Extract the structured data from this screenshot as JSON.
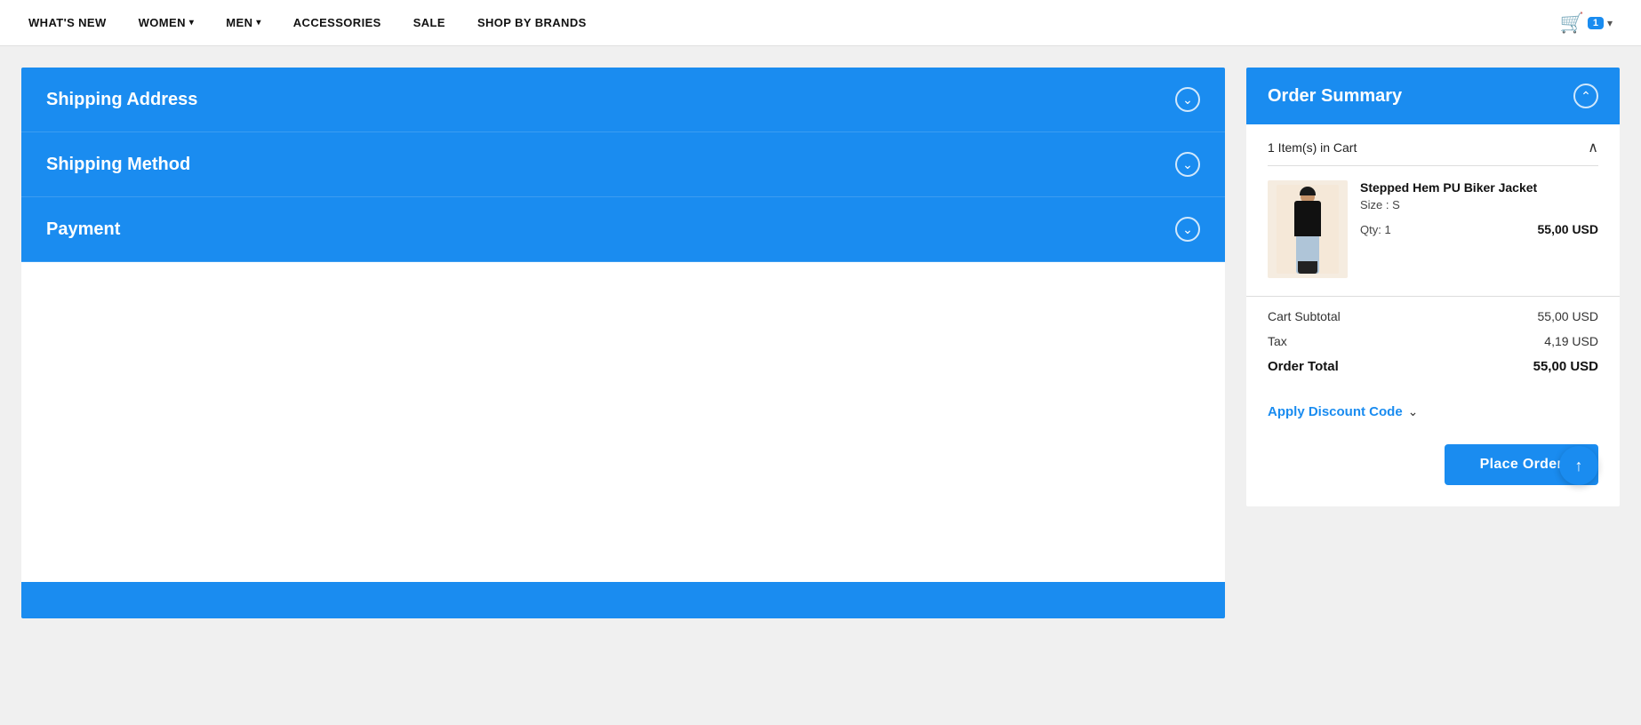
{
  "nav": {
    "items": [
      {
        "label": "WHAT'S NEW",
        "hasDropdown": false
      },
      {
        "label": "WOMEN",
        "hasDropdown": true
      },
      {
        "label": "MEN",
        "hasDropdown": true
      },
      {
        "label": "ACCESSORIES",
        "hasDropdown": false
      },
      {
        "label": "SALE",
        "hasDropdown": false
      },
      {
        "label": "SHOP BY BRANDS",
        "hasDropdown": false
      }
    ],
    "cart": {
      "count": "1",
      "icon": "🛒"
    }
  },
  "checkout": {
    "sections": [
      {
        "id": "shipping-address",
        "label": "Shipping Address"
      },
      {
        "id": "shipping-method",
        "label": "Shipping Method"
      },
      {
        "id": "payment",
        "label": "Payment"
      }
    ]
  },
  "order_summary": {
    "title": "Order Summary",
    "items_in_cart": "1 Item(s) in Cart",
    "item": {
      "name": "Stepped Hem PU Biker Jacket",
      "size_label": "Size",
      "size_value": "S",
      "qty_label": "Qty: 1",
      "price": "55,00 USD"
    },
    "cart_subtotal_label": "Cart Subtotal",
    "cart_subtotal_value": "55,00 USD",
    "tax_label": "Tax",
    "tax_value": "4,19 USD",
    "order_total_label": "Order Total",
    "order_total_value": "55,00 USD",
    "discount_code_label": "Apply Discount Code",
    "place_order_label": "Place Order"
  },
  "colors": {
    "blue": "#1a8cf0",
    "white": "#ffffff",
    "light_gray": "#f0f0f0"
  }
}
